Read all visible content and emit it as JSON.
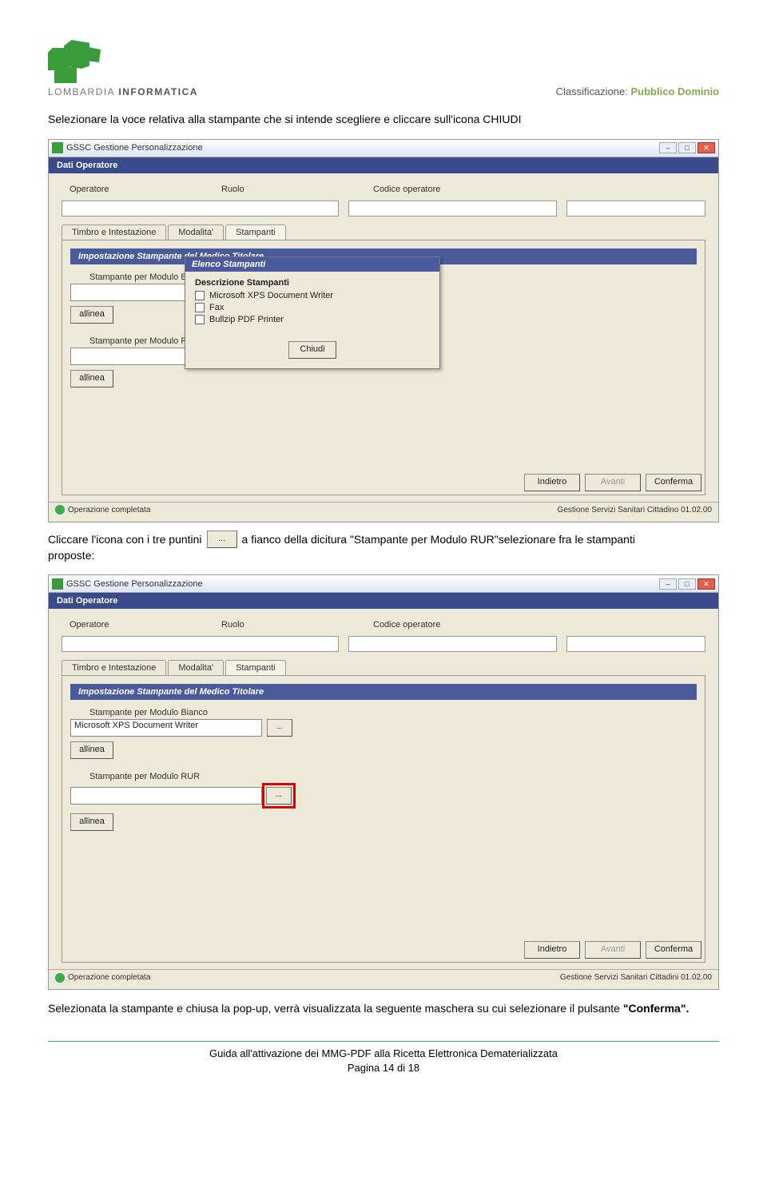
{
  "header": {
    "logo_text_a": "LOMBARDIA ",
    "logo_text_b": "INFORMATICA",
    "classif_label": "Classificazione: ",
    "classif_value": "Pubblico Dominio"
  },
  "text": {
    "p1": "Selezionare la voce relativa alla stampante che si intende scegliere e cliccare sull'icona CHIUDI",
    "p2a": "Cliccare l'icona con i tre puntini",
    "p2b": "a fianco della dicitura \"Stampante per Modulo RUR\"selezionare fra le stampanti",
    "p2c": "proposte:",
    "p3a": "Selezionata la stampante e chiusa la pop-up, verrà visualizzata la seguente maschera su cui selezionare il pulsante ",
    "p3b": "\"Conferma\".",
    "three_dots": "..."
  },
  "shot1": {
    "title": "GSSC Gestione Personalizzazione",
    "section": "Dati Operatore",
    "labels": {
      "operatore": "Operatore",
      "ruolo": "Ruolo",
      "codice": "Codice operatore"
    },
    "tabs": {
      "t1": "Timbro e Intestazione",
      "t2": "Modalita'",
      "t3": "Stampanti"
    },
    "subsection": "Impostazione Stampante del Medico Titolare",
    "f1": "Stampante per Modulo Bia",
    "f2": "Stampante per Modulo R",
    "allinea": "allinea",
    "modal_title": "Elenco Stampanti",
    "modal_sub": "Descrizione Stampanti",
    "printers": [
      "Microsoft XPS Document Writer",
      "Fax",
      "Bullzip PDF Printer"
    ],
    "modal_close": "Chiudi",
    "btn_back": "Indietro",
    "btn_mid": "Avanti",
    "btn_conf": "Conferma",
    "status": "Operazione completata",
    "status_right": "Gestione Servizi Sanitari Cittadino   01.02.00"
  },
  "shot2": {
    "title": "GSSC Gestione Personalizzazione",
    "section": "Dati Operatore",
    "labels": {
      "operatore": "Operatore",
      "ruolo": "Ruolo",
      "codice": "Codice operatore"
    },
    "tabs": {
      "t1": "Timbro e Intestazione",
      "t2": "Modalita'",
      "t3": "Stampanti"
    },
    "subsection": "Impostazione Stampante del Medico Titolare",
    "f1": "Stampante per Modulo Bianco",
    "f1_value": "Microsoft XPS Document Writer",
    "f2": "Stampante per Modulo RUR",
    "allinea": "allinea",
    "btn_back": "Indietro",
    "btn_mid": "Avanti",
    "btn_conf": "Conferma",
    "status": "Operazione completata",
    "status_right": "Gestione Servizi Sanitari Cittadini   01.02.00",
    "three_dots": "..."
  },
  "footer": {
    "line1": "Guida all'attivazione dei MMG-PDF alla Ricetta Elettronica Dematerializzata",
    "line2": "Pagina 14 di 18"
  }
}
